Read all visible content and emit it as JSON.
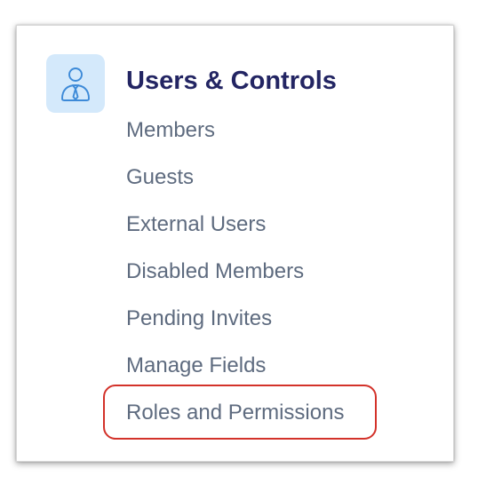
{
  "section": {
    "title": "Users & Controls",
    "icon": "user-tie-icon",
    "icon_bg_color": "#d4e9fb",
    "icon_color": "#3d8ad8",
    "title_color": "#232563"
  },
  "menu": {
    "items": [
      {
        "label": "Members"
      },
      {
        "label": "Guests"
      },
      {
        "label": "External Users"
      },
      {
        "label": "Disabled Members"
      },
      {
        "label": "Pending Invites"
      },
      {
        "label": "Manage Fields"
      },
      {
        "label": "Roles and Permissions",
        "highlighted": true
      }
    ],
    "item_color": "#5e6b7f",
    "highlight_color": "#d3322a"
  }
}
